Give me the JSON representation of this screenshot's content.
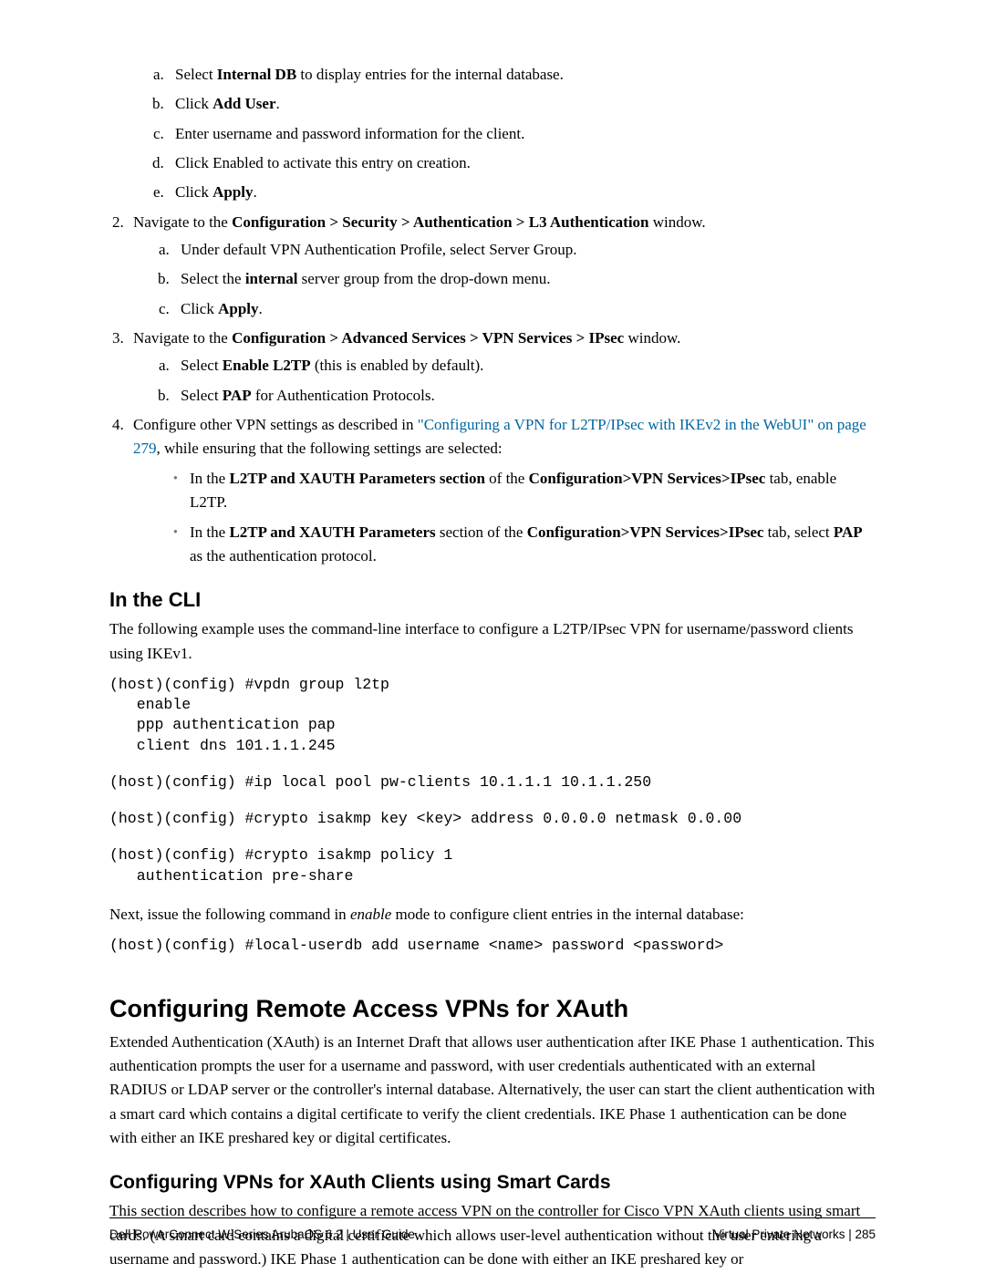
{
  "list1": {
    "a": {
      "pre": "Select ",
      "bold": "Internal DB",
      "post": " to display entries for the internal database."
    },
    "b": {
      "pre": "Click ",
      "bold": "Add User",
      "post": "."
    },
    "c": "Enter username and password information for the client.",
    "d": "Click Enabled to activate this entry on creation.",
    "e": {
      "pre": "Click ",
      "bold": "Apply",
      "post": "."
    }
  },
  "step2": {
    "pre": "Navigate to the ",
    "bold": "Configuration > Security > Authentication > L3 Authentication",
    "post": " window."
  },
  "step2a": "Under default VPN Authentication Profile, select Server Group.",
  "step2b": {
    "pre": "Select the ",
    "bold": "internal",
    "post": " server group from the drop-down menu."
  },
  "step2c": {
    "pre": "Click ",
    "bold": "Apply",
    "post": "."
  },
  "step3": {
    "pre": "Navigate to the ",
    "bold": "Configuration > Advanced Services > VPN Services > IPsec",
    "post": " window."
  },
  "step3a": {
    "pre": "Select ",
    "bold": "Enable L2TP",
    "post": " (this is enabled by default)."
  },
  "step3b": {
    "pre": "Select ",
    "bold": "PAP",
    "post": " for Authentication Protocols."
  },
  "step4": {
    "pre": "Configure other VPN settings as described in ",
    "link": "\"Configuring a VPN for L2TP/IPsec with IKEv2 in the WebUI\" on page 279",
    "post": ", while ensuring that the following settings are selected:"
  },
  "step4b1": {
    "pre": "In the ",
    "b1": "L2TP and XAUTH Parameters section",
    "mid1": " of the ",
    "b2": "Configuration>VPN Services>IPsec",
    "post": " tab, enable L2TP."
  },
  "step4b2": {
    "pre": "In the ",
    "b1": "L2TP and XAUTH Parameters",
    "mid1": " section of the ",
    "b2": "Configuration>VPN Services>IPsec",
    "mid2": " tab, select ",
    "b3": "PAP",
    "post": " as the authentication protocol."
  },
  "cli_heading": "In the CLI",
  "cli_intro": "The following example uses the command-line interface to configure a L2TP/IPsec VPN for username/password clients using IKEv1.",
  "cli_block1": "(host)(config) #vpdn group l2tp\n   enable\n   ppp authentication pap\n   client dns 101.1.1.245",
  "cli_block2": "(host)(config) #ip local pool pw-clients 10.1.1.1 10.1.1.250",
  "cli_block3": "(host)(config) #crypto isakmp key <key> address 0.0.0.0 netmask 0.0.00",
  "cli_block4": "(host)(config) #crypto isakmp policy 1\n   authentication pre-share",
  "cli_next": {
    "pre": "Next, issue the following command in ",
    "ital": "enable",
    "post": " mode to configure client entries in the internal database:"
  },
  "cli_block5": "(host)(config) #local-userdb add username <name> password <password>",
  "xauth_heading": "Configuring Remote Access VPNs for XAuth",
  "xauth_body": "Extended Authentication (XAuth) is an Internet Draft that allows user authentication after IKE Phase 1 authentication. This authentication prompts the user for a username and password, with user credentials authenticated with an external RADIUS or LDAP server or the controller's internal database. Alternatively, the user can start the client authentication with a smart card which contains a digital certificate to verify the client credentials. IKE Phase 1 authentication can be done with either an IKE preshared key or digital certificates.",
  "smartcard_heading": "Configuring VPNs for XAuth Clients using Smart Cards",
  "smartcard_body": "This section describes how to configure a remote access VPN on the controller for Cisco VPN XAuth clients using smart cards. (A smart card contains a digital certificate which allows user-level authentication without the user entering a username and password.) IKE Phase 1 authentication can be done with either an IKE preshared key or",
  "footer_left": "Dell PowerConnect W-Series ArubaOS 6.2   |   User Guide",
  "footer_right": "Virtual Private Networks  |  285"
}
